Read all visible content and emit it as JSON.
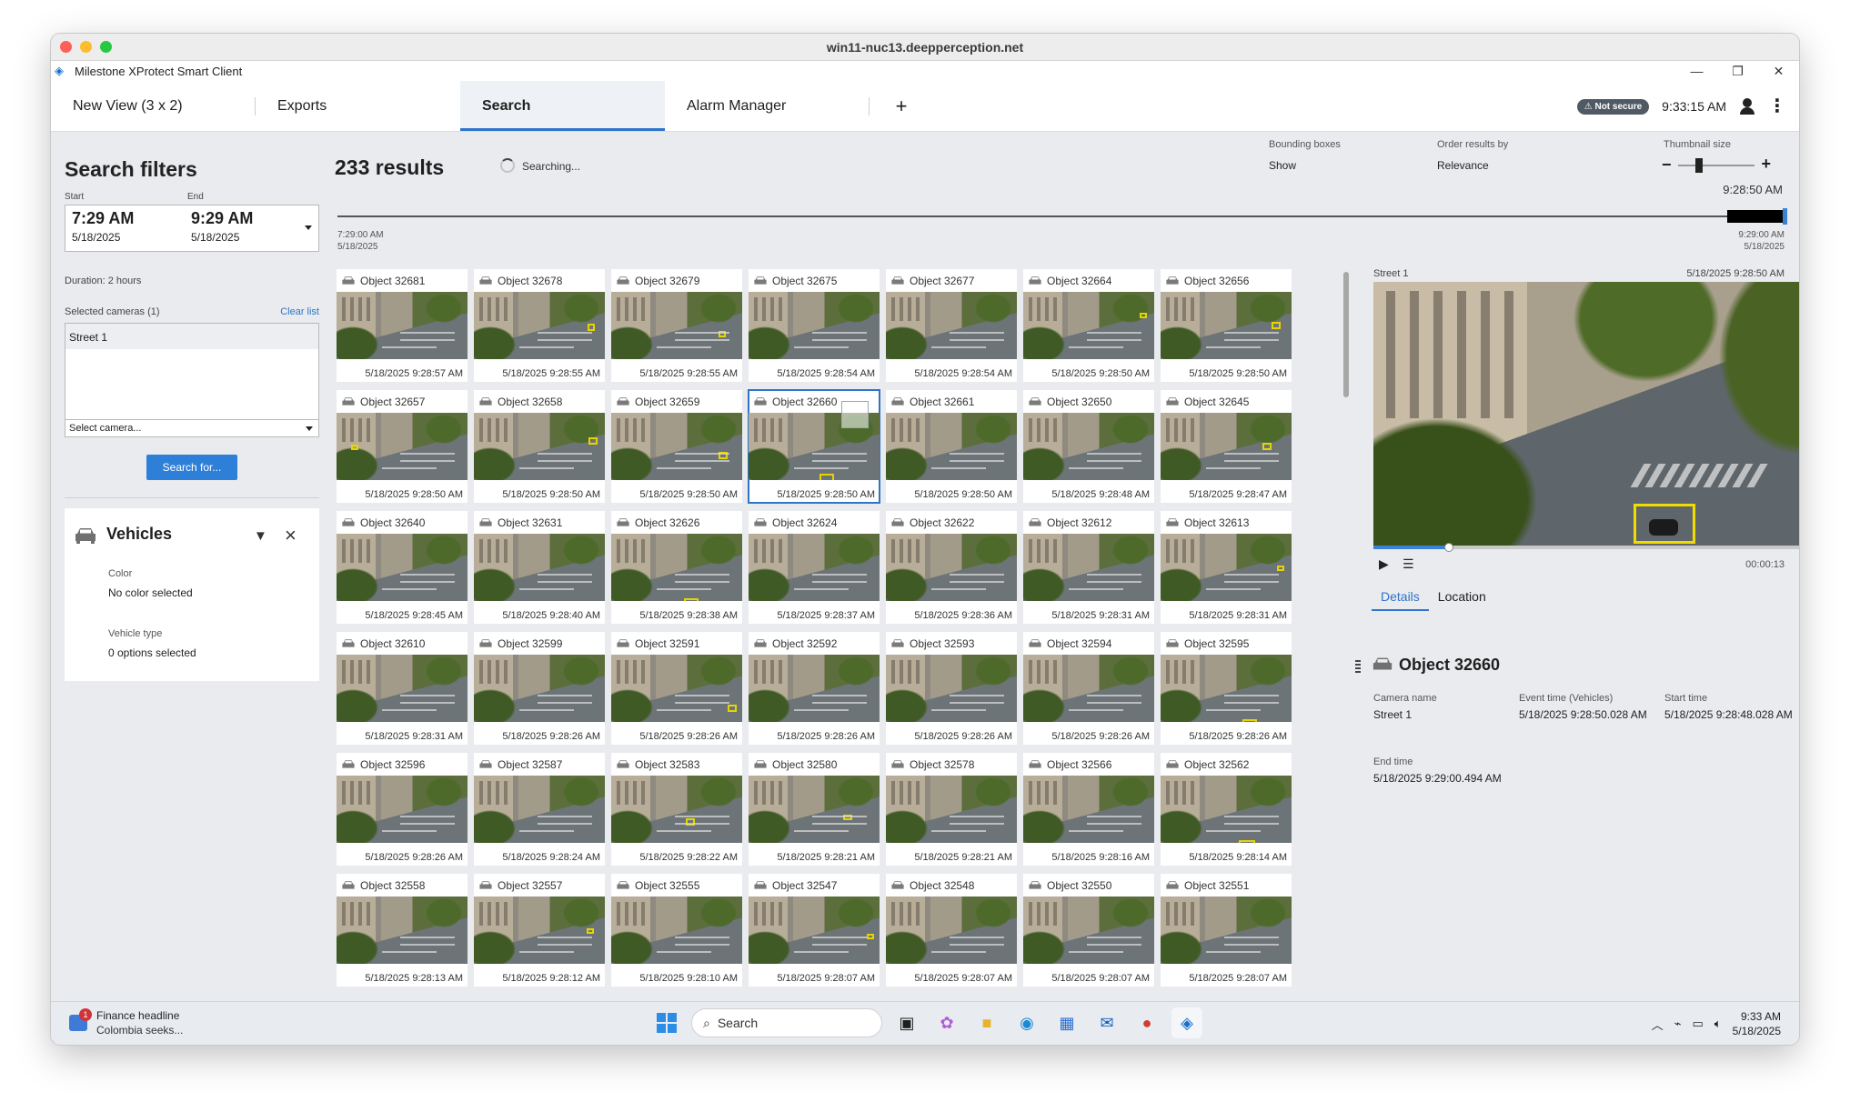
{
  "mac_window": {
    "title": "win11-nuc13.deepperception.net"
  },
  "app": {
    "title": "Milestone XProtect Smart Client"
  },
  "tabs": [
    {
      "label": "New View (3 x 2)"
    },
    {
      "label": "Exports"
    },
    {
      "label": "Search"
    },
    {
      "label": "Alarm Manager"
    }
  ],
  "tab_add": "+",
  "topbar": {
    "security_badge": "⚠ Not secure",
    "clock": "9:33:15 AM"
  },
  "filters": {
    "title": "Search filters",
    "start_label": "Start",
    "end_label": "End",
    "start_time": "7:29 AM",
    "start_date": "5/18/2025",
    "end_time": "9:29 AM",
    "end_date": "5/18/2025",
    "duration": "Duration: 2 hours",
    "selected_cameras": "Selected cameras (1)",
    "clear_list": "Clear list",
    "camera": "Street 1",
    "select_camera": "Select camera...",
    "search_button": "Search for...",
    "vehicles": {
      "title": "Vehicles",
      "color_label": "Color",
      "color_value": "No color selected",
      "type_label": "Vehicle type",
      "type_value": "0 options selected"
    }
  },
  "results": {
    "count": "233 results",
    "status": "Searching...",
    "bounding_boxes_label": "Bounding boxes",
    "bounding_boxes_value": "Show",
    "order_label": "Order results by",
    "order_value": "Relevance",
    "thumb_label": "Thumbnail size",
    "timeline_start_time": "7:29:00 AM",
    "timeline_start_date": "5/18/2025",
    "timeline_end_time": "9:29:00 AM",
    "timeline_end_date": "5/18/2025",
    "timeline_current": "9:28:50 AM"
  },
  "cards": [
    {
      "name": "Object 32681",
      "time": "5/18/2025 9:28:57 AM"
    },
    {
      "name": "Object 32678",
      "time": "5/18/2025 9:28:55 AM"
    },
    {
      "name": "Object 32679",
      "time": "5/18/2025 9:28:55 AM"
    },
    {
      "name": "Object 32675",
      "time": "5/18/2025 9:28:54 AM"
    },
    {
      "name": "Object 32677",
      "time": "5/18/2025 9:28:54 AM"
    },
    {
      "name": "Object 32664",
      "time": "5/18/2025 9:28:50 AM"
    },
    {
      "name": "Object 32656",
      "time": "5/18/2025 9:28:50 AM"
    },
    {
      "name": "Object 32657",
      "time": "5/18/2025 9:28:50 AM"
    },
    {
      "name": "Object 32658",
      "time": "5/18/2025 9:28:50 AM"
    },
    {
      "name": "Object 32659",
      "time": "5/18/2025 9:28:50 AM"
    },
    {
      "name": "Object 32660",
      "time": "5/18/2025 9:28:50 AM"
    },
    {
      "name": "Object 32661",
      "time": "5/18/2025 9:28:50 AM"
    },
    {
      "name": "Object 32650",
      "time": "5/18/2025 9:28:48 AM"
    },
    {
      "name": "Object 32645",
      "time": "5/18/2025 9:28:47 AM"
    },
    {
      "name": "Object 32640",
      "time": "5/18/2025 9:28:45 AM"
    },
    {
      "name": "Object 32631",
      "time": "5/18/2025 9:28:40 AM"
    },
    {
      "name": "Object 32626",
      "time": "5/18/2025 9:28:38 AM"
    },
    {
      "name": "Object 32624",
      "time": "5/18/2025 9:28:37 AM"
    },
    {
      "name": "Object 32622",
      "time": "5/18/2025 9:28:36 AM"
    },
    {
      "name": "Object 32612",
      "time": "5/18/2025 9:28:31 AM"
    },
    {
      "name": "Object 32613",
      "time": "5/18/2025 9:28:31 AM"
    },
    {
      "name": "Object 32610",
      "time": "5/18/2025 9:28:31 AM"
    },
    {
      "name": "Object 32599",
      "time": "5/18/2025 9:28:26 AM"
    },
    {
      "name": "Object 32591",
      "time": "5/18/2025 9:28:26 AM"
    },
    {
      "name": "Object 32592",
      "time": "5/18/2025 9:28:26 AM"
    },
    {
      "name": "Object 32593",
      "time": "5/18/2025 9:28:26 AM"
    },
    {
      "name": "Object 32594",
      "time": "5/18/2025 9:28:26 AM"
    },
    {
      "name": "Object 32595",
      "time": "5/18/2025 9:28:26 AM"
    },
    {
      "name": "Object 32596",
      "time": "5/18/2025 9:28:26 AM"
    },
    {
      "name": "Object 32587",
      "time": "5/18/2025 9:28:24 AM"
    },
    {
      "name": "Object 32583",
      "time": "5/18/2025 9:28:22 AM"
    },
    {
      "name": "Object 32580",
      "time": "5/18/2025 9:28:21 AM"
    },
    {
      "name": "Object 32578",
      "time": "5/18/2025 9:28:21 AM"
    },
    {
      "name": "Object 32566",
      "time": "5/18/2025 9:28:16 AM"
    },
    {
      "name": "Object 32562",
      "time": "5/18/2025 9:28:14 AM"
    },
    {
      "name": "Object 32558",
      "time": "5/18/2025 9:28:13 AM"
    },
    {
      "name": "Object 32557",
      "time": "5/18/2025 9:28:12 AM"
    },
    {
      "name": "Object 32555",
      "time": "5/18/2025 9:28:10 AM"
    },
    {
      "name": "Object 32547",
      "time": "5/18/2025 9:28:07 AM"
    },
    {
      "name": "Object 32548",
      "time": "5/18/2025 9:28:07 AM"
    },
    {
      "name": "Object 32550",
      "time": "5/18/2025 9:28:07 AM"
    },
    {
      "name": "Object 32551",
      "time": "5/18/2025 9:28:07 AM"
    }
  ],
  "preview": {
    "camera": "Street 1",
    "timestamp": "5/18/2025 9:28:50 AM",
    "duration": "00:00:13",
    "tab_details": "Details",
    "tab_location": "Location",
    "object_title": "Object 32660",
    "camera_name_label": "Camera name",
    "camera_name_value": "Street 1",
    "event_time_label": "Event time (Vehicles)",
    "event_time_value": "5/18/2025 9:28:50.028 AM",
    "start_time_label": "Start time",
    "start_time_value": "5/18/2025 9:28:48.028 AM",
    "end_time_label": "End time",
    "end_time_value": "5/18/2025 9:29:00.494 AM"
  },
  "taskbar": {
    "news_badge": "1",
    "news_title": "Finance headline",
    "news_sub": "Colombia seeks...",
    "search": "Search",
    "time": "9:33 AM",
    "date": "5/18/2025"
  },
  "colors": {
    "accent": "#2e74c9",
    "bbox": "#e5d400",
    "button": "#2e7fd8"
  }
}
